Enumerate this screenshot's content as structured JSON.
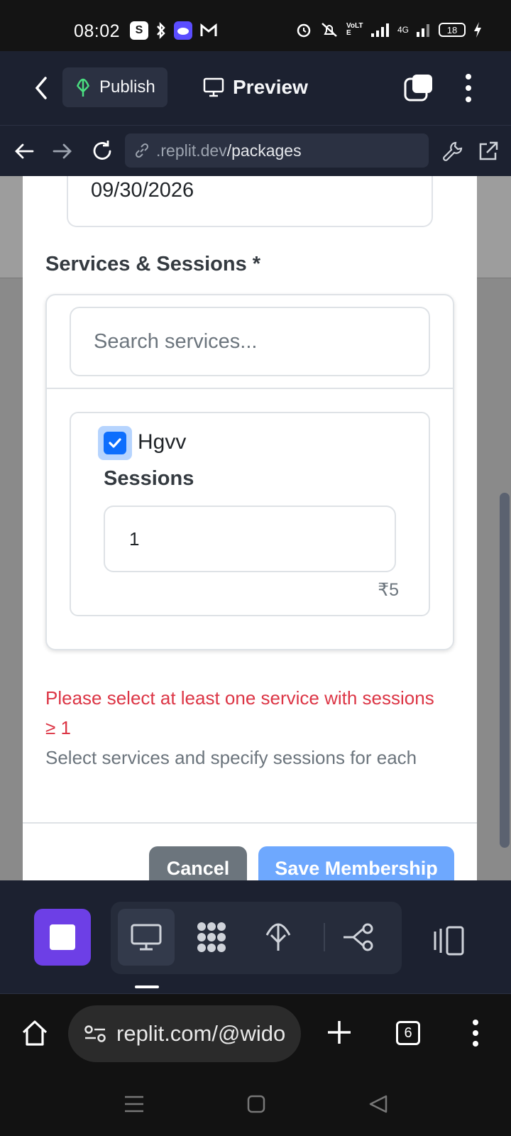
{
  "status_bar": {
    "time": "08:02",
    "battery": "18",
    "network": "4G",
    "volte": "VoLTE"
  },
  "header": {
    "publish_label": "Publish",
    "preview_label": "Preview"
  },
  "url_bar": {
    "domain": ".replit.dev",
    "path": "/packages"
  },
  "form": {
    "end_date_value": "09/30/2026",
    "services_label": "Services & Sessions *",
    "search_placeholder": "Search services...",
    "services": [
      {
        "name": "Hgvv",
        "checked": true,
        "sessions_label": "Sessions",
        "sessions_value": "1",
        "price": "₹5"
      }
    ],
    "error_message": "Please select at least one service with sessions ≥ 1",
    "help_text": "Select services and specify sessions for each",
    "cancel_label": "Cancel",
    "save_label": "Save Membership"
  },
  "chrome": {
    "url": "replit.com/@wido",
    "tab_count": "6"
  },
  "colors": {
    "primary": "#0d6efd",
    "primary_disabled": "#6ea8fe",
    "danger": "#dc3545",
    "secondary": "#6c757d",
    "replit_purple": "#6d3fe6",
    "replit_bg": "#1c2130"
  }
}
